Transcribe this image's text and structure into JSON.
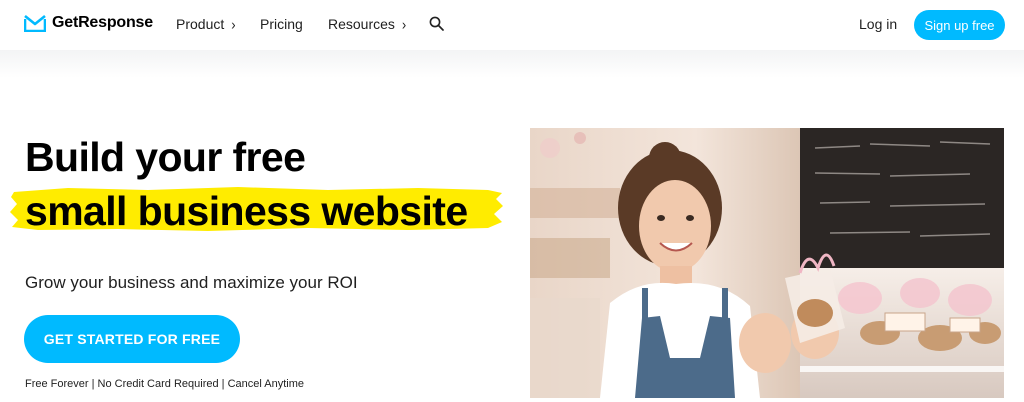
{
  "brand": {
    "name": "GetResponse",
    "accent": "#00baff",
    "highlight": "#ffec00"
  },
  "nav": {
    "product": "Product",
    "pricing": "Pricing",
    "resources": "Resources",
    "chevron": "›",
    "search_icon": "search-icon",
    "login": "Log in",
    "signup": "Sign up free"
  },
  "hero": {
    "title_line1": "Build your free",
    "title_line2": "small business website",
    "subtitle": "Grow your business and maximize your ROI",
    "cta": "GET STARTED FOR FREE",
    "fineprint": "Free Forever | No Credit Card Required | Cancel Anytime",
    "photo_desc": "shop-assistant-photo"
  }
}
